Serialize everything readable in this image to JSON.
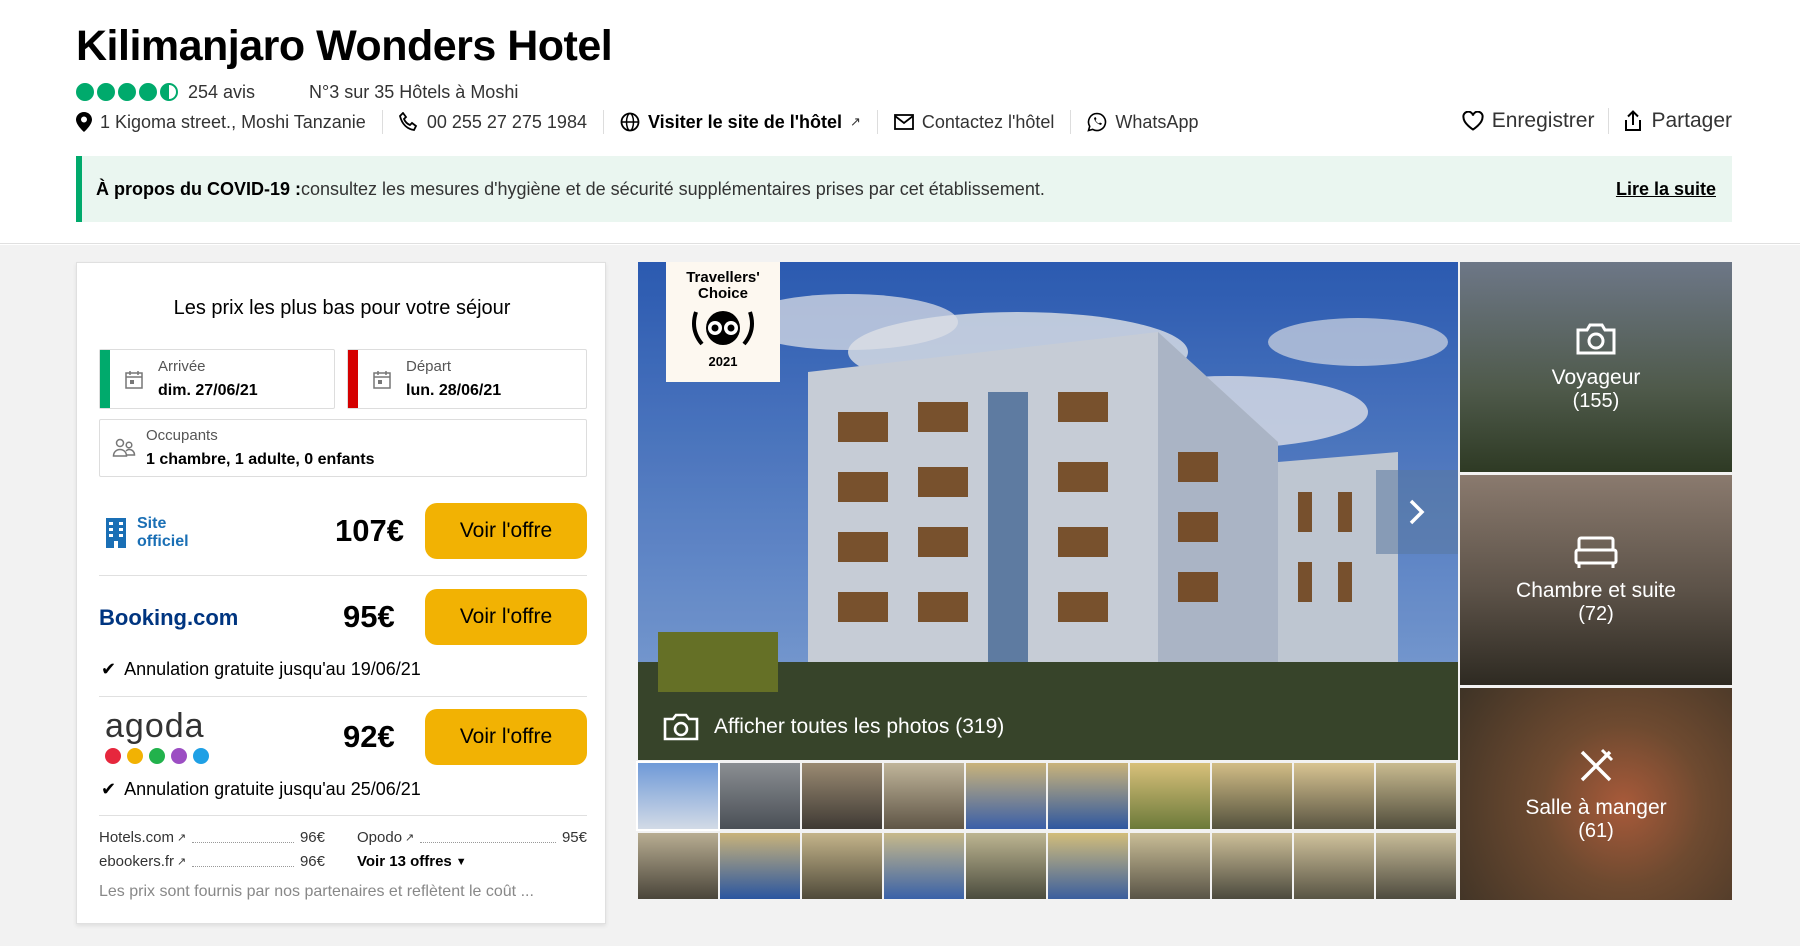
{
  "header": {
    "hotel_name": "Kilimanjaro Wonders Hotel",
    "rating_bubbles": 4.5,
    "reviews": "254 avis",
    "rank": "N°3 sur 35 Hôtels à Moshi",
    "address": "1 Kigoma street., Moshi Tanzanie",
    "phone": "00 255 27 275 1984",
    "website": "Visiter le site de l'hôtel",
    "contact": "Contactez l'hôtel",
    "whatsapp": "WhatsApp",
    "save": "Enregistrer",
    "share": "Partager"
  },
  "covid": {
    "prefix": "À propos du COVID-19 :",
    "text": " consultez les mesures d'hygiène et de sécurité supplémentaires prises par cet établissement.",
    "more": "Lire la suite"
  },
  "booking": {
    "title": "Les prix les plus bas pour votre séjour",
    "checkin_label": "Arrivée",
    "checkin_value": "dim. 27/06/21",
    "checkout_label": "Départ",
    "checkout_value": "lun. 28/06/21",
    "guests_label": "Occupants",
    "guests_value": "1 chambre, 1 adulte, 0 enfants",
    "offers": [
      {
        "provider": "Site officiel",
        "price": "107€",
        "button": "Voir l'offre"
      },
      {
        "provider": "Booking.com",
        "price": "95€",
        "button": "Voir l'offre",
        "cancel": "Annulation gratuite jusqu'au 19/06/21"
      },
      {
        "provider": "agoda",
        "price": "92€",
        "button": "Voir l'offre",
        "cancel": "Annulation gratuite jusqu'au 25/06/21"
      }
    ],
    "other_offers": [
      {
        "name": "Hotels.com",
        "price": "96€"
      },
      {
        "name": "ebookers.fr",
        "price": "96€"
      },
      {
        "name": "Opodo",
        "price": "95€"
      }
    ],
    "more_offers": "Voir 13 offres",
    "footnote": "Les prix sont fournis par nos partenaires et reflètent le coût ..."
  },
  "photos": {
    "badge_title": "Travellers' Choice",
    "badge_year": "2021",
    "all_photos": "Afficher toutes les photos (319)",
    "categories": [
      {
        "label": "Voyageur",
        "count": "(155)"
      },
      {
        "label": "Chambre et suite",
        "count": "(72)"
      },
      {
        "label": "Salle à manger",
        "count": "(61)"
      }
    ]
  },
  "colors": {
    "rating_green": "#00aa6c",
    "button_yellow": "#f2b203",
    "booking_blue": "#003580",
    "official_blue": "#1a6fb5"
  }
}
